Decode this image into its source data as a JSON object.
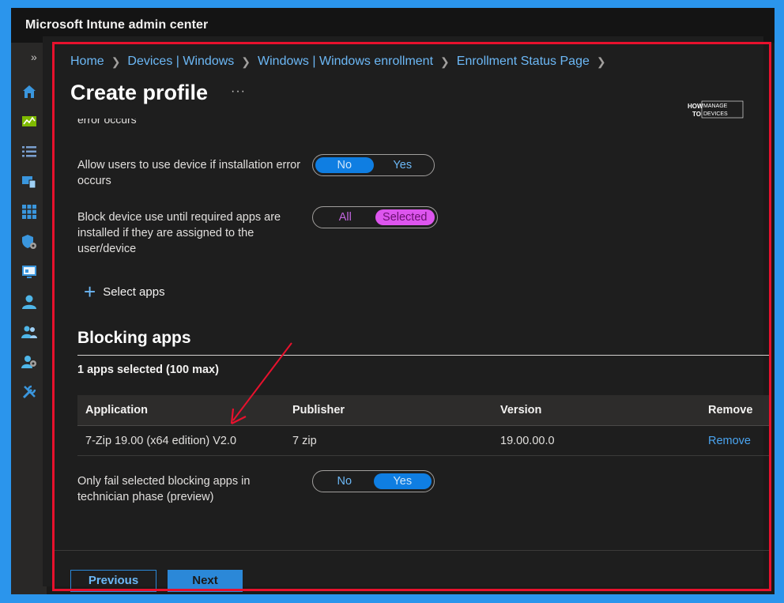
{
  "app": {
    "title": "Microsoft Intune admin center"
  },
  "sidebar": {
    "expand_glyph": "»",
    "items": [
      {
        "name": "home-icon",
        "color": "#3a96dd"
      },
      {
        "name": "dashboard-icon",
        "color": "#7fba00"
      },
      {
        "name": "all-services-icon",
        "color": "#7a9fcf"
      },
      {
        "name": "devices-icon",
        "color": "#3a96dd"
      },
      {
        "name": "apps-icon",
        "color": "#3a96dd"
      },
      {
        "name": "endpoint-security-icon",
        "color": "#3a96dd"
      },
      {
        "name": "reports-icon",
        "color": "#3a96dd"
      },
      {
        "name": "users-icon",
        "color": "#4fb6e8"
      },
      {
        "name": "groups-icon",
        "color": "#4fb6e8"
      },
      {
        "name": "tenant-admin-icon",
        "color": "#4fb6e8"
      },
      {
        "name": "troubleshooting-icon",
        "color": "#3a96dd"
      }
    ]
  },
  "breadcrumb": [
    "Home",
    "Devices | Windows",
    "Windows | Windows enrollment",
    "Enrollment Status Page"
  ],
  "page": {
    "title": "Create profile",
    "more": "···"
  },
  "logo": {
    "line1": "HOW",
    "line2": "TO",
    "line3": "MANAGE",
    "line4": "DEVICES"
  },
  "settings": {
    "cut_text": "error occurs",
    "allow_use": {
      "label": "Allow users to use device if installation error occurs",
      "options": [
        "No",
        "Yes"
      ],
      "selected": "No"
    },
    "block_use": {
      "label": "Block device use until required apps are installed if they are assigned to the user/device",
      "options": [
        "All",
        "Selected"
      ],
      "selected": "Selected"
    },
    "select_apps": "Select apps"
  },
  "blocking": {
    "title": "Blocking apps",
    "count": "1 apps selected (100 max)",
    "columns": [
      "Application",
      "Publisher",
      "Version",
      "Remove"
    ],
    "rows": [
      {
        "application": "7-Zip 19.00 (x64 edition) V2.0",
        "publisher": "7 zip",
        "version": "19.00.00.0",
        "remove": "Remove"
      }
    ],
    "only_fail": {
      "label": "Only fail selected blocking apps in technician phase (preview)",
      "options": [
        "No",
        "Yes"
      ],
      "selected": "Yes"
    }
  },
  "footer": {
    "previous": "Previous",
    "next": "Next"
  },
  "colors": {
    "accent": "#2b88d8",
    "highlight_border": "#e8112d",
    "selected_pink": "#dd55ee"
  }
}
